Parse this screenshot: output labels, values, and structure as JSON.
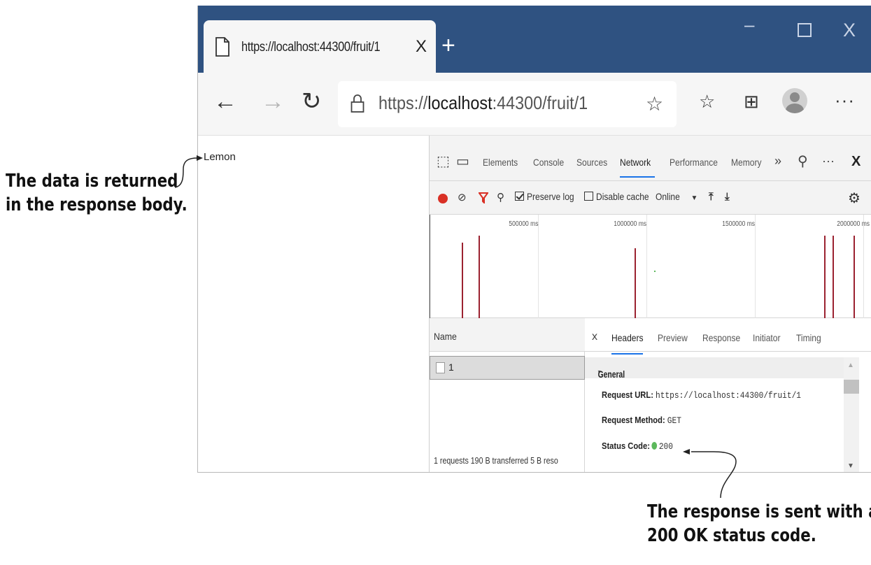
{
  "browser": {
    "tab_title": "https://localhost:44300/fruit/1",
    "tab_close": "X",
    "new_tab": "+",
    "win_minimize": "–",
    "win_close": "X",
    "nav_back": "←",
    "nav_forward": "→",
    "nav_reload": "↻",
    "url_prefix": "https://",
    "url_host": "localhost",
    "url_rest": ":44300/fruit/1",
    "more": "···"
  },
  "page": {
    "body_text": "Lemon"
  },
  "devtools": {
    "tabs": [
      "Elements",
      "Console",
      "Sources",
      "Network",
      "Performance",
      "Memory"
    ],
    "active_tab": "Network",
    "overflow": "»",
    "more": "···",
    "close": "X",
    "controls": {
      "preserve_log": "Preserve log",
      "disable_cache": "Disable cache",
      "throttle": "Online",
      "throttle_arrow": "▼"
    },
    "timeline_ticks": [
      "500000 ms",
      "1000000 ms",
      "1500000 ms",
      "2000000 ms"
    ],
    "requests": {
      "column_header": "Name",
      "rows": [
        "1"
      ],
      "summary": "1 requests  190 B transferred  5 B reso"
    },
    "detail": {
      "close": "x",
      "tabs": [
        "Headers",
        "Preview",
        "Response",
        "Initiator",
        "Timing"
      ],
      "active_tab": "Headers",
      "section": "General",
      "section_arrow": "▾",
      "request_url_label": "Request URL:",
      "request_url_value": "https://localhost:44300/fruit/1",
      "request_method_label": "Request Method:",
      "request_method_value": "GET",
      "status_code_label": "Status Code:",
      "status_code_value": "200",
      "status_color": "#5cb85c"
    }
  },
  "annotations": {
    "left_line1": "The data is returned",
    "left_line2": "in the response body.",
    "bottom_line1": "The response is sent with a",
    "bottom_line2": "200 OK status code."
  },
  "colors": {
    "titlebar": "#2f5281",
    "record": "#d93025",
    "accent": "#1a73e8",
    "timeline_bar": "#9b2230"
  }
}
